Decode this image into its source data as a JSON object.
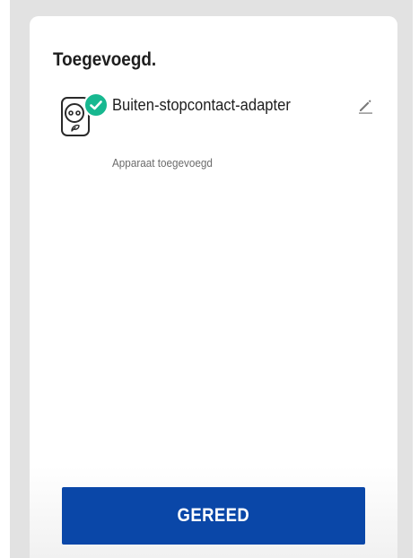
{
  "screen": {
    "title": "Toegevoegd."
  },
  "device": {
    "name": "Buiten-stopcontact-adapter",
    "status": "Apparaat toegevoegd",
    "icon": "outdoor-socket-adapter-icon",
    "badge_icon": "check-icon",
    "edit_icon": "pencil-icon"
  },
  "actions": {
    "done_label": "GEREED"
  },
  "colors": {
    "accent": "#0a47a8",
    "success": "#17b890",
    "backdrop": "#e2e2e2"
  }
}
